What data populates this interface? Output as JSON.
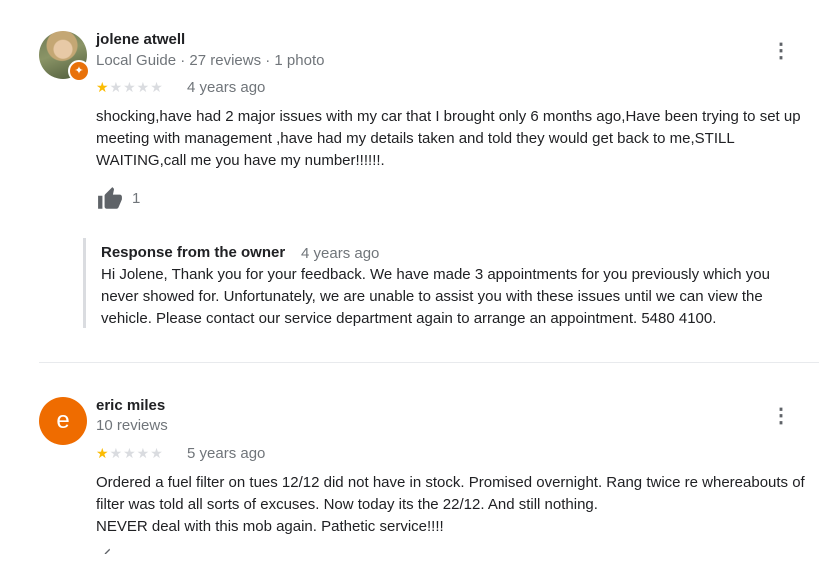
{
  "reviews": [
    {
      "author": "jolene atwell",
      "meta": "Local Guide · 27 reviews · 1 photo",
      "stars": "★",
      "stars_off": "★★★★",
      "rating": 1,
      "age": "4 years ago",
      "text": "shocking,have had 2 major issues with my car that I brought only 6 months ago,Have been trying to set up meeting with management ,have had my details taken and told they would get back to me,STILL WAITING,call me you have my number!!!!!!.",
      "likes": "1",
      "response": {
        "label": "Response from the owner",
        "age": "4 years ago",
        "text": "Hi Jolene, Thank you for your feedback. We have made 3 appointments for you previously which you never showed for. Unfortunately, we are unable to assist you with these issues until we can view the vehicle. Please contact our service department again to arrange an appointment. 5480 4100."
      },
      "icons": {
        "avatar": "profile-photo",
        "badge": "local-guide-star-icon",
        "more": "more-vert-icon",
        "like": "thumb-up-icon"
      }
    },
    {
      "author": "eric miles",
      "avatar_letter": "e",
      "meta": "10 reviews",
      "stars": "★",
      "stars_off": "★★★★",
      "rating": 1,
      "age": "5 years ago",
      "text": "Ordered a fuel filter on tues 12/12 did not have in stock. Promised overnight. Rang twice re whereabouts of filter was told all sorts of excuses. Now today its the 22/12. And still nothing.\nNEVER deal with this mob again. Pathetic service!!!!",
      "icons": {
        "more": "more-vert-icon",
        "like": "thumb-up-icon"
      }
    }
  ],
  "colors": {
    "star_on": "#fbbc04",
    "star_off": "#dadce0",
    "avatar_orange": "#ef6c00",
    "badge_orange": "#e8710a",
    "muted_text": "#70757a",
    "icon_grey": "#5f6368"
  },
  "glyphs": {
    "more": "⋮",
    "badge": "✦"
  }
}
